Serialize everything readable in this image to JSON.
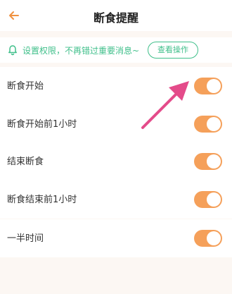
{
  "header": {
    "title": "断食提醒",
    "back_icon": "back-arrow-icon"
  },
  "notice": {
    "icon": "bell-icon",
    "text": "设置权限，不再错过重要消息~",
    "button_label": "查看操作",
    "color": "#3fbf8a"
  },
  "groups": [
    {
      "rows": [
        {
          "label": "断食开始",
          "enabled": true
        },
        {
          "label": "断食开始前1小时",
          "enabled": true
        }
      ]
    },
    {
      "rows": [
        {
          "label": "结束断食",
          "enabled": true
        },
        {
          "label": "断食结束前1小时",
          "enabled": true
        }
      ]
    },
    {
      "rows": [
        {
          "label": "一半时间",
          "enabled": true
        }
      ]
    }
  ],
  "colors": {
    "toggle_on": "#f5a05a",
    "accent_back": "#f0913f",
    "annotation_arrow": "#e44b8a"
  }
}
